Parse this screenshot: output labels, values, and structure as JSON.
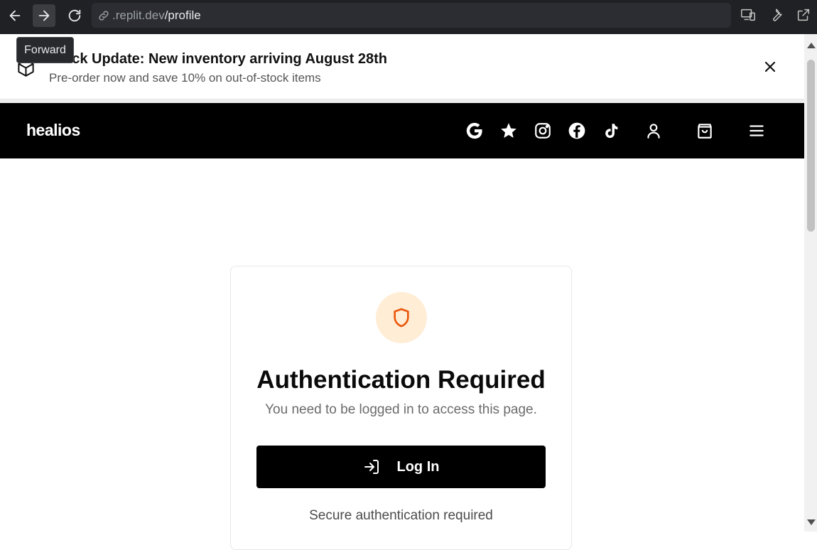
{
  "browser": {
    "url_host": ".replit.dev",
    "url_path": "/profile",
    "tooltip": "Forward"
  },
  "announcement": {
    "title": "Stock Update: New inventory arriving August 28th",
    "subtitle": "Pre-order now and save 10% on out-of-stock items",
    "icon": "box-icon",
    "close_icon": "close-icon"
  },
  "header": {
    "logo": "healios",
    "icons": [
      "google-icon",
      "star-icon",
      "instagram-icon",
      "facebook-icon",
      "tiktok-icon",
      "user-icon",
      "cart-icon",
      "menu-icon"
    ]
  },
  "auth_card": {
    "icon": "shield-icon",
    "title": "Authentication Required",
    "subtitle": "You need to be logged in to access this page.",
    "button_label": "Log In",
    "footer": "Secure authentication required"
  },
  "colors": {
    "header_bg": "#000000",
    "shield_bg": "#ffedd5",
    "shield_stroke": "#ea580c",
    "button_bg": "#000000",
    "browser_bg": "#202124"
  }
}
